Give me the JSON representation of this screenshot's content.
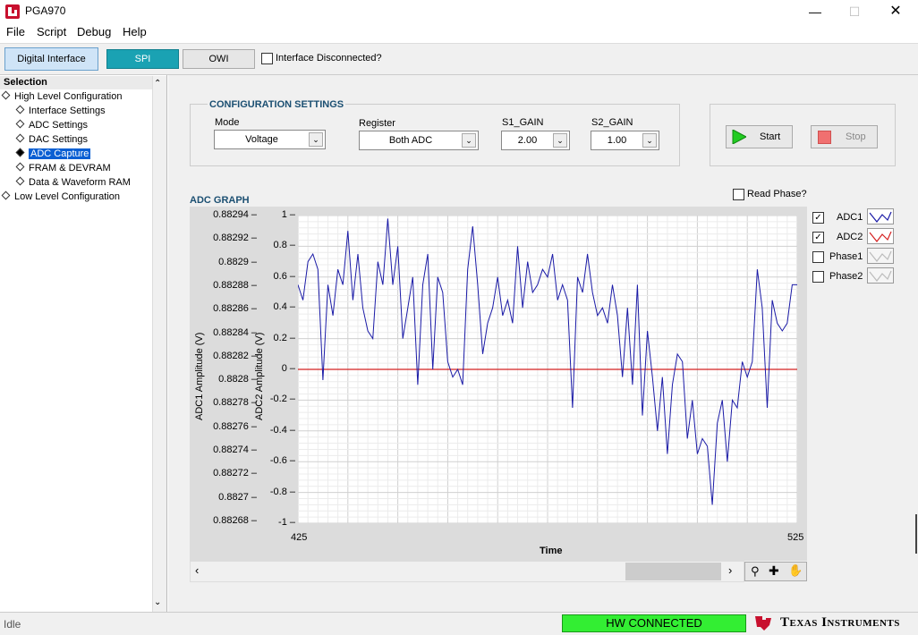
{
  "window": {
    "title": "PGA970"
  },
  "menu": {
    "items": [
      "File",
      "Script",
      "Debug",
      "Help"
    ]
  },
  "toolbar": {
    "digital_interface": "Digital Interface",
    "spi": "SPI",
    "owi": "OWI",
    "interface_disconnected": "Interface Disconnected?",
    "interface_disconnected_checked": false
  },
  "sidebar": {
    "header": "Selection",
    "items": [
      {
        "label": "High Level Configuration",
        "level": 0,
        "selected": false
      },
      {
        "label": "Interface Settings",
        "level": 1,
        "selected": false
      },
      {
        "label": "ADC Settings",
        "level": 1,
        "selected": false
      },
      {
        "label": "DAC Settings",
        "level": 1,
        "selected": false
      },
      {
        "label": "ADC Capture",
        "level": 1,
        "selected": true
      },
      {
        "label": "FRAM & DEVRAM",
        "level": 1,
        "selected": false
      },
      {
        "label": "Data & Waveform RAM",
        "level": 1,
        "selected": false
      },
      {
        "label": "Low Level Configuration",
        "level": 0,
        "selected": false
      }
    ]
  },
  "config": {
    "header": "CONFIGURATION SETTINGS",
    "mode_label": "Mode",
    "mode_value": "Voltage",
    "register_label": "Register",
    "register_value": "Both ADC",
    "s1_label": "S1_GAIN",
    "s1_value": "2.00",
    "s2_label": "S2_GAIN",
    "s2_value": "1.00",
    "start": "Start",
    "stop": "Stop"
  },
  "graph": {
    "header": "ADC GRAPH",
    "read_phase": "Read Phase?",
    "read_phase_checked": false,
    "y1_label": "ADC1 Amplitude (V)",
    "y2_label": "ADC2 Amplitude (V)",
    "x_label": "Time",
    "x_min_label": "425",
    "x_max_label": "525"
  },
  "legend": [
    {
      "label": "ADC1",
      "checked": true,
      "color": "#1a1aa6"
    },
    {
      "label": "ADC2",
      "checked": true,
      "color": "#d42020"
    },
    {
      "label": "Phase1",
      "checked": false,
      "color": "#bbbbbb"
    },
    {
      "label": "Phase2",
      "checked": false,
      "color": "#bbbbbb"
    }
  ],
  "colors": {
    "adc1": "#1a1aa6",
    "adc2": "#d42020",
    "hw_connected": "#33ee33",
    "accent": "#1aa2b3"
  },
  "status": {
    "text": "Idle",
    "hw": "HW CONNECTED",
    "brand": "Texas Instruments"
  },
  "chart_data": {
    "type": "line",
    "title": "ADC GRAPH",
    "xlabel": "Time",
    "ylabel": "ADC1 Amplitude (V)",
    "y2label": "ADC2 Amplitude (V)",
    "xlim": [
      425,
      525
    ],
    "ylim": [
      -1,
      1
    ],
    "y1_ticks": [
      "0.88294",
      "0.88292",
      "0.8829",
      "0.88288",
      "0.88286",
      "0.88284",
      "0.88282",
      "0.8828",
      "0.88278",
      "0.88276",
      "0.88274",
      "0.88272",
      "0.8827",
      "0.88268"
    ],
    "y2_ticks": [
      "1",
      "0.8",
      "0.6",
      "0.4",
      "0.2",
      "0",
      "-0.2",
      "-0.4",
      "-0.6",
      "-0.8",
      "-1"
    ],
    "grid": true,
    "series": [
      {
        "name": "ADC1",
        "values": [
          0.55,
          0.45,
          0.7,
          0.75,
          0.65,
          -0.07,
          0.55,
          0.35,
          0.65,
          0.55,
          0.9,
          0.45,
          0.75,
          0.4,
          0.25,
          0.2,
          0.7,
          0.55,
          0.98,
          0.55,
          0.8,
          0.2,
          0.4,
          0.6,
          -0.1,
          0.55,
          0.75,
          0.0,
          0.6,
          0.5,
          0.05,
          -0.05,
          0.0,
          -0.1,
          0.65,
          0.93,
          0.55,
          0.1,
          0.3,
          0.4,
          0.6,
          0.35,
          0.45,
          0.3,
          0.8,
          0.4,
          0.7,
          0.5,
          0.55,
          0.65,
          0.6,
          0.75,
          0.45,
          0.55,
          0.45,
          -0.25,
          0.6,
          0.5,
          0.75,
          0.5,
          0.35,
          0.4,
          0.3,
          0.55,
          0.35,
          -0.05,
          0.4,
          -0.1,
          0.55,
          -0.3,
          0.25,
          -0.05,
          -0.4,
          -0.05,
          -0.55,
          -0.1,
          0.1,
          0.05,
          -0.45,
          -0.2,
          -0.55,
          -0.45,
          -0.5,
          -0.88,
          -0.35,
          -0.2,
          -0.6,
          -0.2,
          -0.25,
          0.05,
          -0.05,
          0.05,
          0.65,
          0.4,
          -0.25,
          0.45,
          0.3,
          0.25,
          0.3,
          0.55,
          0.55
        ]
      },
      {
        "name": "ADC2",
        "values": [
          0,
          0
        ]
      }
    ]
  }
}
